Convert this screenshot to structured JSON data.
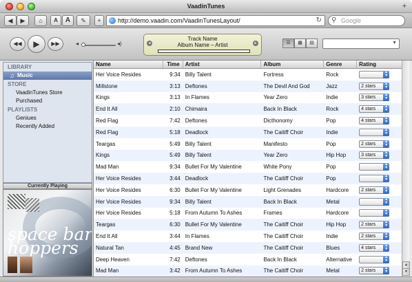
{
  "window": {
    "title": "VaadinTunes"
  },
  "browser": {
    "url": "http://demo.vaadin.com/VaadinTunesLayout/",
    "search_placeholder": "Google",
    "font_small_label": "A",
    "font_large_label": "A"
  },
  "player": {
    "track_name": "Track Name",
    "album_artist": "Album Name – Artist",
    "progress": 0.0
  },
  "sidebar": {
    "library_header": "LIBRARY",
    "music_label": "Music",
    "store_header": "STORE",
    "store_items": [
      "VaadinTunes Store",
      "Purchased"
    ],
    "playlists_header": "PLAYLISTS",
    "playlist_items": [
      "Geniues",
      "Recently Added"
    ]
  },
  "now_playing": {
    "header": "Currently Playing",
    "cover_text": "space bar hoppers"
  },
  "table": {
    "columns": [
      "Name",
      "Time",
      "Artist",
      "Album",
      "Genre",
      "Rating"
    ],
    "rows": [
      {
        "name": "Her Voice Resides",
        "time": "9:34",
        "artist": "Billy Talent",
        "album": "Fortress",
        "genre": "Rock",
        "rating": ""
      },
      {
        "name": "Millstone",
        "time": "3:13",
        "artist": "Deftones",
        "album": "The Devil And God",
        "genre": "Jazz",
        "rating": "2 stars"
      },
      {
        "name": "Kings",
        "time": "3:13",
        "artist": "In Flames",
        "album": "Year Zero",
        "genre": "Indie",
        "rating": "3 stars"
      },
      {
        "name": "End It All",
        "time": "2:10",
        "artist": "Chimaira",
        "album": "Back In Black",
        "genre": "Rock",
        "rating": "4 stars"
      },
      {
        "name": "Red Flag",
        "time": "7:42",
        "artist": "Deftones",
        "album": "Dicthonomy",
        "genre": "Pop",
        "rating": "4 stars"
      },
      {
        "name": "Red Flag",
        "time": "5:18",
        "artist": "Deadlock",
        "album": "The Caitiff Choir",
        "genre": "Indie",
        "rating": ""
      },
      {
        "name": "Teargas",
        "time": "5:49",
        "artist": "Billy Talent",
        "album": "Manifesto",
        "genre": "Pop",
        "rating": "2 stars"
      },
      {
        "name": "Kings",
        "time": "5:49",
        "artist": "Billy Talent",
        "album": "Year Zero",
        "genre": "Hip Hop",
        "rating": "3 stars"
      },
      {
        "name": "Mad Man",
        "time": "9:34",
        "artist": "Bullet For My Valentine",
        "album": "White Pony",
        "genre": "Pop",
        "rating": ""
      },
      {
        "name": "Her Voice Resides",
        "time": "3:44",
        "artist": "Deadlock",
        "album": "The Caitiff Choir",
        "genre": "Pop",
        "rating": ""
      },
      {
        "name": "Her Voice Resides",
        "time": "6:30",
        "artist": "Bullet For My Valentine",
        "album": "Light Grenades",
        "genre": "Hardcore",
        "rating": "2 stars"
      },
      {
        "name": "Her Voice Resides",
        "time": "9:34",
        "artist": "Billy Talent",
        "album": "Back In Black",
        "genre": "Metal",
        "rating": ""
      },
      {
        "name": "Her Voice Resides",
        "time": "5:18",
        "artist": "From Autumn To Ashes",
        "album": "Frames",
        "genre": "Hardcore",
        "rating": ""
      },
      {
        "name": "Teargas",
        "time": "6:30",
        "artist": "Bullet For My Valentine",
        "album": "The Caitiff Choir",
        "genre": "Hip Hop",
        "rating": "2 stars"
      },
      {
        "name": "End It All",
        "time": "3:44",
        "artist": "In Flames",
        "album": "The Caitiff Choir",
        "genre": "Indie",
        "rating": "2 stars"
      },
      {
        "name": "Natural Tan",
        "time": "4:45",
        "artist": "Brand New",
        "album": "The Caitiff Choir",
        "genre": "Blues",
        "rating": "4 stars"
      },
      {
        "name": "Deep Heaven",
        "time": "7:42",
        "artist": "Deftones",
        "album": "Back In Black",
        "genre": "Alternative",
        "rating": ""
      },
      {
        "name": "Mad Man",
        "time": "3:42",
        "artist": "From Autumn To Ashes",
        "album": "The Caitiff Choir",
        "genre": "Metal",
        "rating": "2 stars"
      }
    ]
  },
  "icons": {
    "back": "back-arrow-icon",
    "forward": "forward-arrow-icon",
    "home": "home-icon",
    "rewind": "rewind-icon",
    "play": "play-icon",
    "fast_forward": "fast-forward-icon",
    "volume_low": "volume-low-icon",
    "volume_high": "volume-high-icon",
    "reload": "reload-icon",
    "search": "search-icon",
    "music_note": "music-note-icon"
  },
  "colors": {
    "row_alt": "#edf3fe",
    "selection": "#5d78a8",
    "rating_arrow": "#2e66c4"
  }
}
